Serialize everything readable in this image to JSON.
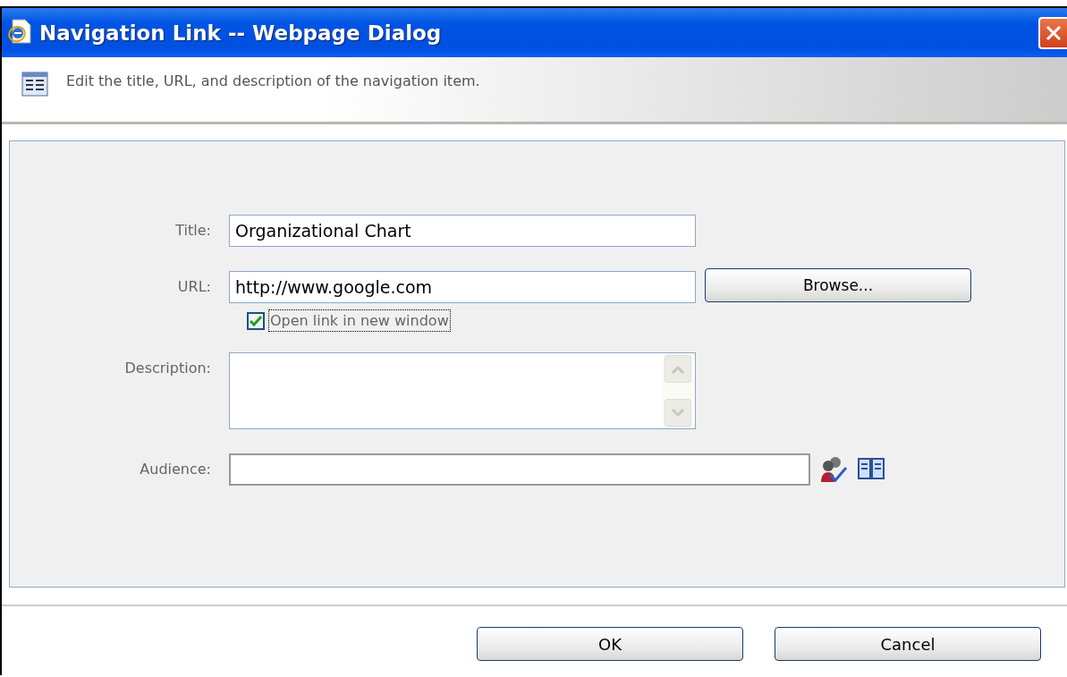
{
  "window": {
    "title": "Navigation Link -- Webpage Dialog"
  },
  "header": {
    "text": "Edit the title, URL, and description of the navigation item."
  },
  "fields": [
    {
      "kind": "text",
      "label": "Title:",
      "value": "Organizational Chart"
    },
    {
      "kind": "url",
      "label": "URL:",
      "value": "http://www.google.com",
      "button": "Browse..."
    },
    {
      "kind": "checkbox",
      "label": "Open link in new window",
      "checked": true
    },
    {
      "kind": "textarea",
      "label": "Description:"
    },
    {
      "kind": "people",
      "label": "Audience:"
    }
  ],
  "buttons": [
    "OK",
    "Cancel"
  ]
}
